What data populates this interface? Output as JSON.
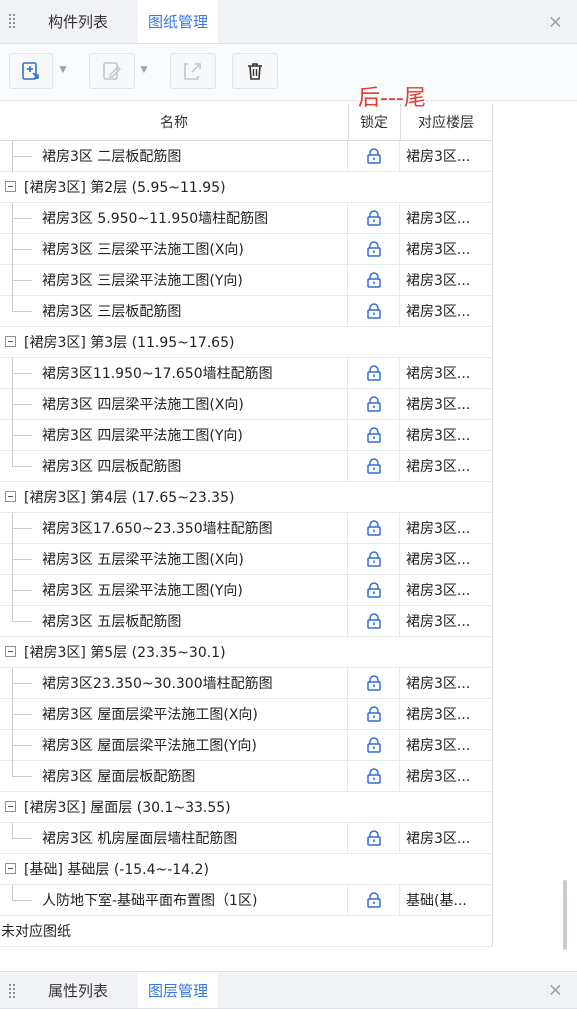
{
  "top_tabs": [
    {
      "label": "构件列表",
      "active": false
    },
    {
      "label": "图纸管理",
      "active": true
    }
  ],
  "bottom_tabs": [
    {
      "label": "属性列表",
      "active": false
    },
    {
      "label": "图层管理",
      "active": true
    }
  ],
  "close_glyph": "×",
  "toolbar": {
    "buttons": [
      "add-drawing-icon",
      "edit-drawing-icon",
      "export-drawing-icon",
      "delete-icon"
    ]
  },
  "annotation": "后---尾",
  "columns": {
    "name": "名称",
    "lock": "锁定",
    "floor": "对应楼层"
  },
  "rows": [
    {
      "type": "drawing",
      "name": "裙房3区 二层板配筋图",
      "floor": "裙房3区...",
      "branch_top": true
    },
    {
      "type": "group",
      "name": "[裙房3区] 第2层 (5.95~11.95)"
    },
    {
      "type": "drawing",
      "name": "裙房3区 5.950~11.950墙柱配筋图",
      "floor": "裙房3区..."
    },
    {
      "type": "drawing",
      "name": "裙房3区 三层梁平法施工图(X向)",
      "floor": "裙房3区..."
    },
    {
      "type": "drawing",
      "name": "裙房3区 三层梁平法施工图(Y向)",
      "floor": "裙房3区..."
    },
    {
      "type": "drawing",
      "name": "裙房3区 三层板配筋图",
      "floor": "裙房3区...",
      "last": true
    },
    {
      "type": "group",
      "name": "[裙房3区] 第3层 (11.95~17.65)"
    },
    {
      "type": "drawing",
      "name": "裙房3区11.950~17.650墙柱配筋图",
      "floor": "裙房3区..."
    },
    {
      "type": "drawing",
      "name": "裙房3区 四层梁平法施工图(X向)",
      "floor": "裙房3区..."
    },
    {
      "type": "drawing",
      "name": "裙房3区 四层梁平法施工图(Y向)",
      "floor": "裙房3区..."
    },
    {
      "type": "drawing",
      "name": "裙房3区 四层板配筋图",
      "floor": "裙房3区...",
      "last": true
    },
    {
      "type": "group",
      "name": "[裙房3区] 第4层 (17.65~23.35)"
    },
    {
      "type": "drawing",
      "name": "裙房3区17.650~23.350墙柱配筋图",
      "floor": "裙房3区..."
    },
    {
      "type": "drawing",
      "name": "裙房3区 五层梁平法施工图(X向)",
      "floor": "裙房3区..."
    },
    {
      "type": "drawing",
      "name": "裙房3区 五层梁平法施工图(Y向)",
      "floor": "裙房3区..."
    },
    {
      "type": "drawing",
      "name": "裙房3区  五层板配筋图",
      "floor": "裙房3区...",
      "last": true
    },
    {
      "type": "group",
      "name": "[裙房3区] 第5层 (23.35~30.1)"
    },
    {
      "type": "drawing",
      "name": "裙房3区23.350~30.300墙柱配筋图",
      "floor": "裙房3区..."
    },
    {
      "type": "drawing",
      "name": "裙房3区 屋面层梁平法施工图(X向)",
      "floor": "裙房3区..."
    },
    {
      "type": "drawing",
      "name": "裙房3区 屋面层梁平法施工图(Y向)",
      "floor": "裙房3区..."
    },
    {
      "type": "drawing",
      "name": "裙房3区 屋面层板配筋图",
      "floor": "裙房3区...",
      "last": true
    },
    {
      "type": "group",
      "name": "[裙房3区] 屋面层 (30.1~33.55)"
    },
    {
      "type": "drawing",
      "name": "裙房3区 机房屋面层墙柱配筋图",
      "floor": "裙房3区...",
      "last": true
    },
    {
      "type": "group",
      "name": "[基础] 基础层 (-15.4~-14.2)"
    },
    {
      "type": "drawing",
      "name": "人防地下室-基础平面布置图（1区)",
      "floor": "基础(基...",
      "last": true
    },
    {
      "type": "unassigned",
      "name": "未对应图纸"
    }
  ],
  "colors": {
    "accent": "#3477e5",
    "annotation": "#e53b2c",
    "lock": "#2f6fd6"
  }
}
